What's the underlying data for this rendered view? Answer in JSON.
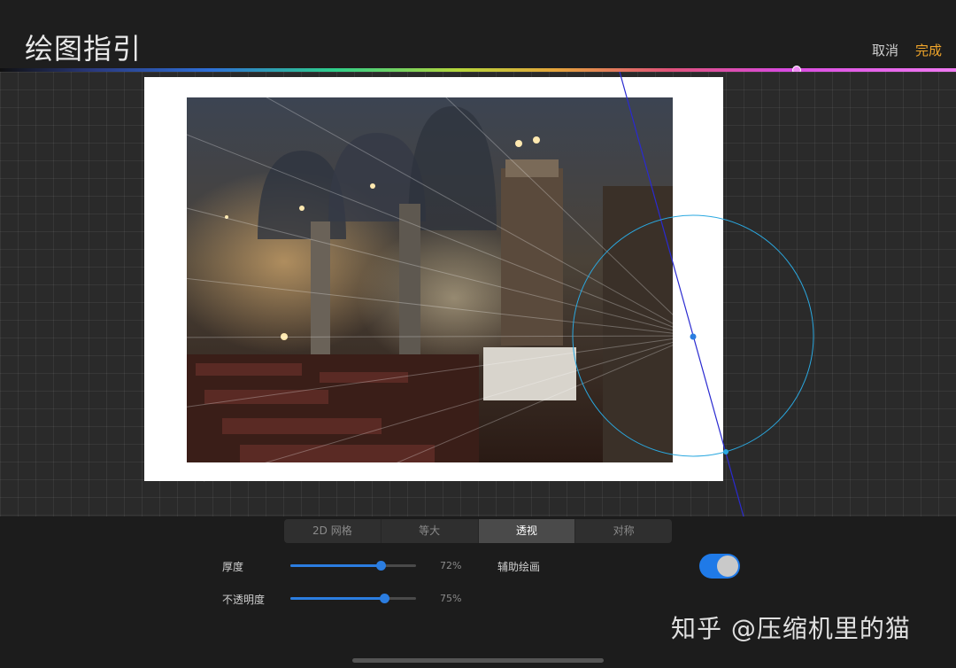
{
  "header": {
    "title": "绘图指引",
    "cancel_label": "取消",
    "done_label": "完成"
  },
  "colors": {
    "accent": "#2b7de0",
    "done": "#f0a52a",
    "guide_line": "#2a2ad0",
    "guide_circle": "#2aa8e0"
  },
  "canvas": {
    "image_description_icon": "photo-icon"
  },
  "tabs": [
    {
      "label": "2D 网格",
      "active": false
    },
    {
      "label": "等大",
      "active": false
    },
    {
      "label": "透视",
      "active": true
    },
    {
      "label": "对称",
      "active": false
    }
  ],
  "settings": {
    "thickness": {
      "label": "厚度",
      "value": 0.72,
      "value_text": "72%"
    },
    "opacity": {
      "label": "不透明度",
      "value": 0.75,
      "value_text": "75%"
    },
    "assist": {
      "label": "辅助绘画",
      "enabled": true
    }
  },
  "watermark": "知乎 @压缩机里的猫"
}
